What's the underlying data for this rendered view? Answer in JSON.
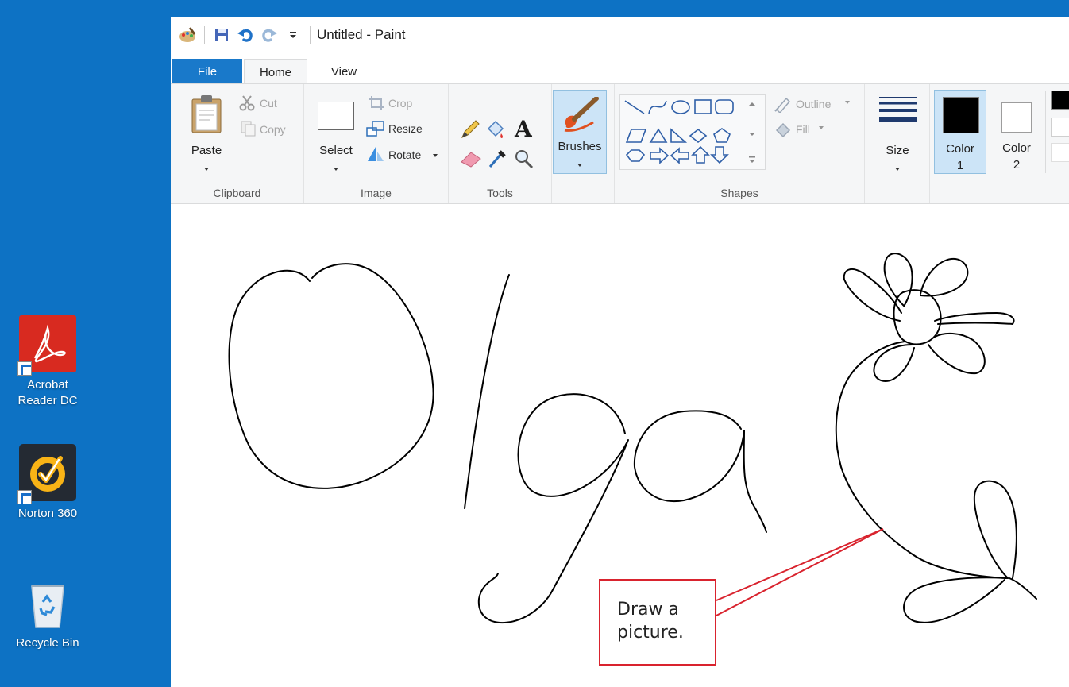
{
  "desktop": {
    "icons": [
      {
        "label": "Acrobat Reader DC",
        "line1": "Acrobat",
        "line2": "Reader DC"
      },
      {
        "label": "Norton 360"
      },
      {
        "label": "Recycle Bin"
      }
    ]
  },
  "window": {
    "title": "Untitled - Paint"
  },
  "tabs": {
    "file": "File",
    "home": "Home",
    "view": "View"
  },
  "ribbon": {
    "clipboard": {
      "paste": "Paste",
      "cut": "Cut",
      "copy": "Copy",
      "group_label": "Clipboard"
    },
    "image": {
      "select": "Select",
      "crop": "Crop",
      "resize": "Resize",
      "rotate": "Rotate",
      "group_label": "Image"
    },
    "tools": {
      "group_label": "Tools"
    },
    "brushes": {
      "label": "Brushes"
    },
    "shapes": {
      "outline": "Outline",
      "fill": "Fill",
      "group_label": "Shapes"
    },
    "size": {
      "label": "Size"
    },
    "color1": {
      "label": "Color",
      "num": "1",
      "value": "#000000"
    },
    "color2": {
      "label": "Color",
      "num": "2",
      "value": "#ffffff"
    }
  },
  "callout": {
    "line1": "Draw a",
    "line2": "picture."
  },
  "colors": {
    "desktop": "#0d72c4",
    "file_tab": "#1979ca",
    "ribbon_bg": "#f5f6f7",
    "selected": "#cce4f7",
    "callout_border": "#d9232e",
    "ink": "#000000"
  }
}
